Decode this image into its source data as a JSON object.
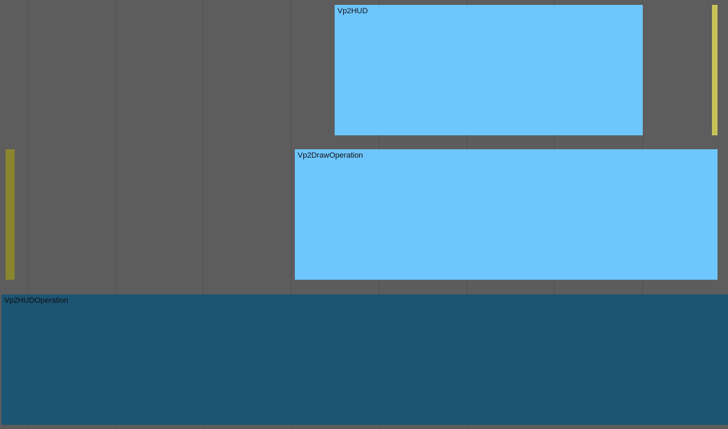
{
  "colors": {
    "background": "#5d5d5d",
    "gridline": "#525252",
    "event_light": "#6ec6ff",
    "event_dark": "#1c5473",
    "marker_yellow_bright": "#c7c35a",
    "marker_yellow_dim": "#8a8630"
  },
  "events": {
    "hud": {
      "label": "Vp2HUD"
    },
    "draw_operation": {
      "label": "Vp2DrawOperation"
    },
    "hud_operation": {
      "label": "Vp2HUDOperation"
    }
  },
  "markers": {
    "row1_end": {
      "color_key": "marker_yellow_bright"
    },
    "row2_start": {
      "color_key": "marker_yellow_dim"
    }
  }
}
